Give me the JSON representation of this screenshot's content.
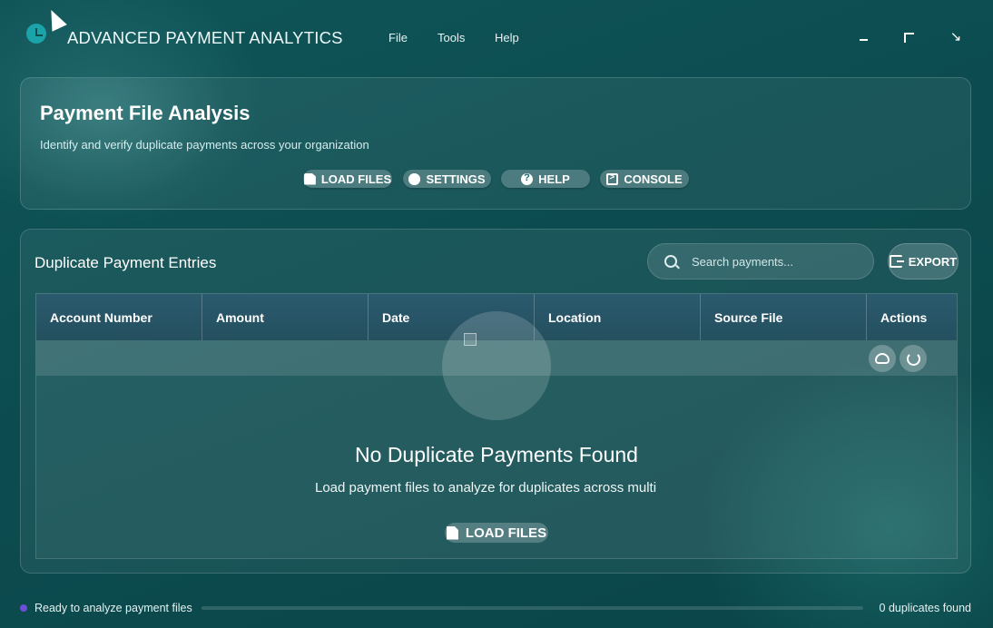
{
  "app": {
    "title": "ADVANCED PAYMENT ANALYTICS"
  },
  "menu": [
    "File",
    "Tools",
    "Help"
  ],
  "window_controls": {
    "minimize": "minimize-icon",
    "maximize": "maximize-icon",
    "close": "↘"
  },
  "header": {
    "title": "Payment File Analysis",
    "subtitle": "Identify and verify duplicate payments across your organization",
    "buttons": [
      {
        "label": "LOAD FILES",
        "icon": "file-icon"
      },
      {
        "label": "SETTINGS",
        "icon": "gear-icon"
      },
      {
        "label": "HELP",
        "icon": "help-icon"
      },
      {
        "label": "CONSOLE",
        "icon": "console-icon"
      }
    ]
  },
  "main": {
    "section_title": "Duplicate Payment Entries",
    "search_placeholder": "Search payments...",
    "export_label": "EXPORT",
    "columns": [
      "Account Number",
      "Amount",
      "Date",
      "Location",
      "Source File",
      "Actions"
    ],
    "row_actions": [
      "view-icon",
      "verify-icon"
    ],
    "empty_title": "No Duplicate Payments Found",
    "empty_subtitle": "Load payment files to analyze for duplicates across multi",
    "empty_button": "LOAD FILES"
  },
  "status": {
    "text": "Ready to analyze payment files",
    "dot_color": "#6d4fd6",
    "progress": 0,
    "count_text": "0 duplicates found"
  }
}
